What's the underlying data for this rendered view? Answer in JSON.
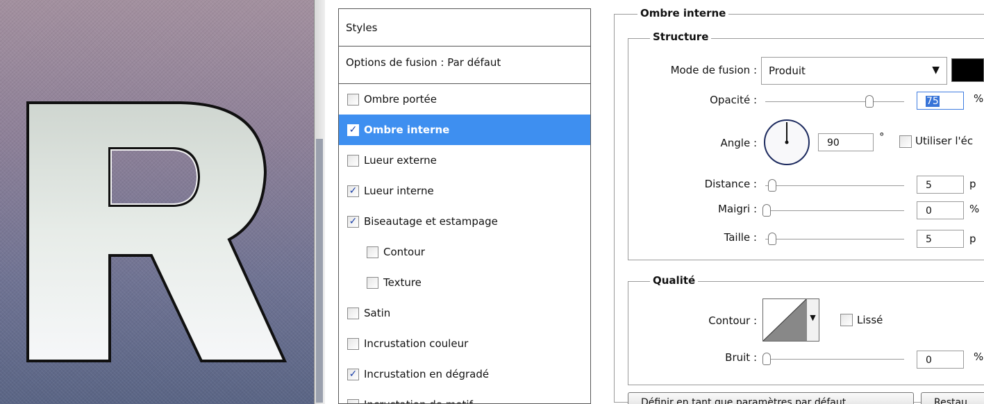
{
  "preview": {
    "letter": "R"
  },
  "styles_panel": {
    "header": "Styles",
    "blend_options": "Options de fusion : Par défaut",
    "items": [
      {
        "label": "Ombre portée",
        "checked": false,
        "selected": false,
        "sub": false
      },
      {
        "label": "Ombre interne",
        "checked": true,
        "selected": true,
        "sub": false
      },
      {
        "label": "Lueur externe",
        "checked": false,
        "selected": false,
        "sub": false
      },
      {
        "label": "Lueur interne",
        "checked": true,
        "selected": false,
        "sub": false
      },
      {
        "label": "Biseautage et estampage",
        "checked": true,
        "selected": false,
        "sub": false
      },
      {
        "label": "Contour",
        "checked": false,
        "selected": false,
        "sub": true
      },
      {
        "label": "Texture",
        "checked": false,
        "selected": false,
        "sub": true
      },
      {
        "label": "Satin",
        "checked": false,
        "selected": false,
        "sub": false
      },
      {
        "label": "Incrustation couleur",
        "checked": false,
        "selected": false,
        "sub": false
      },
      {
        "label": "Incrustation en dégradé",
        "checked": true,
        "selected": false,
        "sub": false
      },
      {
        "label": "Incrustation de motif",
        "checked": false,
        "selected": false,
        "sub": false
      }
    ]
  },
  "settings": {
    "section_title": "Ombre interne",
    "structure": {
      "title": "Structure",
      "blend_mode_label": "Mode de fusion :",
      "blend_mode_value": "Produit",
      "color_swatch": "#000000",
      "opacity_label": "Opacité :",
      "opacity_value": "75",
      "opacity_unit": "%",
      "opacity_level": 0.75,
      "angle_label": "Angle :",
      "angle_value": "90",
      "angle_unit": "°",
      "global_light_label": "Utiliser l'éc",
      "distance_label": "Distance :",
      "distance_value": "5",
      "distance_unit": "p",
      "choke_label": "Maigri :",
      "choke_value": "0",
      "choke_unit": "%",
      "size_label": "Taille :",
      "size_value": "5",
      "size_unit": "p"
    },
    "quality": {
      "title": "Qualité",
      "contour_label": "Contour :",
      "antialias_label": "Lissé",
      "noise_label": "Bruit :",
      "noise_value": "0",
      "noise_unit": "%"
    },
    "buttons": {
      "set_default": "Définir en tant que paramètres par défaut",
      "reset_default": "Restau"
    }
  },
  "colors": {
    "selection": "#3e8ff0",
    "checkmark": "#1a3fa8"
  }
}
